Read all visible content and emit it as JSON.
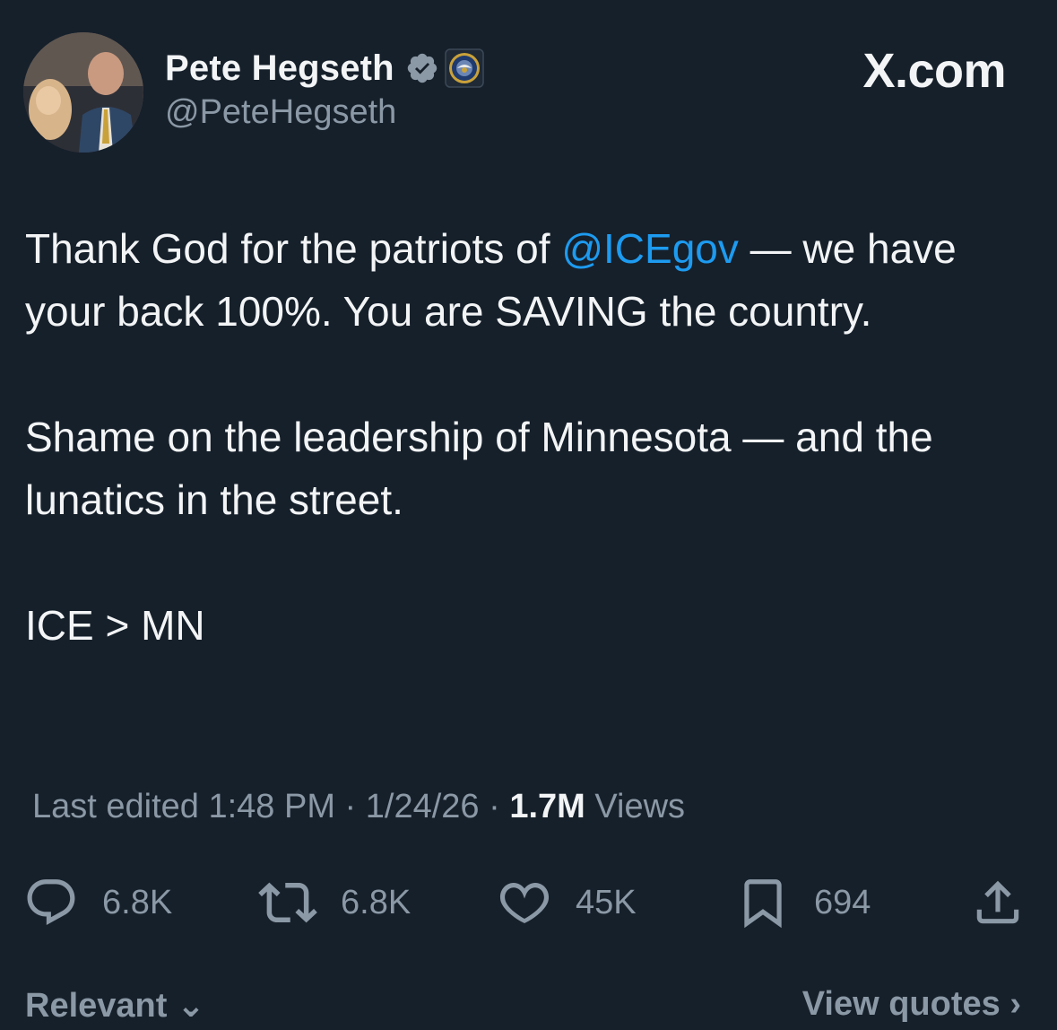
{
  "author": {
    "display_name": "Pete Hegseth",
    "handle": "@PeteHegseth",
    "verified_icon": "verified-badge-icon",
    "affiliation_icon": "department-seal-icon"
  },
  "site": {
    "brand": "X.com"
  },
  "tweet": {
    "p1_before": "Thank God for the patriots of ",
    "p1_mention": "@ICEgov",
    "p1_after": " — we have your back 100%. You are SAVING the country.",
    "p2": "Shame on the leadership of Minnesota — and the lunatics in the street.",
    "p3": "ICE > MN"
  },
  "meta": {
    "edited_prefix": "Last edited 1:48 PM · 1/24/26 · ",
    "views_count": "1.7M",
    "views_label": " Views"
  },
  "actions": {
    "replies": "6.8K",
    "reposts": "6.8K",
    "likes": "45K",
    "bookmarks": "694"
  },
  "footer": {
    "relevant": "Relevant ⌄",
    "view_quotes": "View quotes ›"
  },
  "colors": {
    "background": "#16202b",
    "accent": "#1d9bf0",
    "muted": "#8b98a5"
  }
}
